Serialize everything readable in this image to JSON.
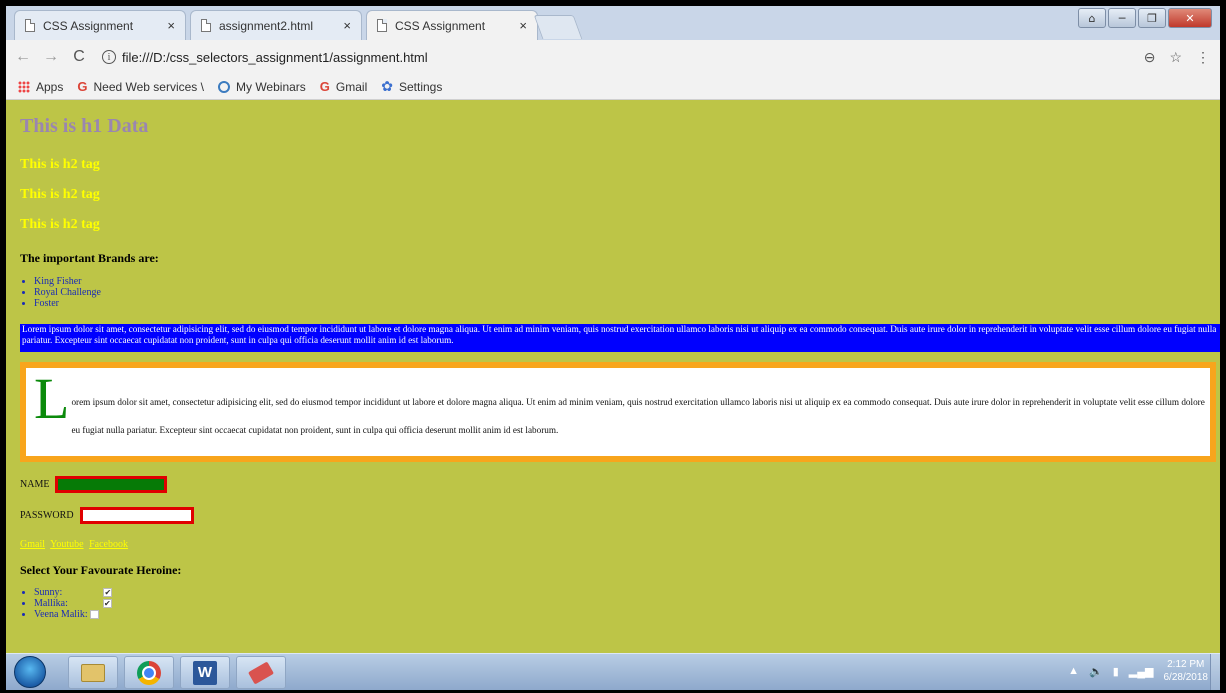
{
  "tabs": [
    {
      "title": "CSS Assignment",
      "close": "×",
      "active": false
    },
    {
      "title": "assignment2.html",
      "close": "×",
      "active": false
    },
    {
      "title": "CSS Assignment",
      "close": "×",
      "active": true
    }
  ],
  "window_controls": {
    "minimize": "─",
    "maximize": "❐",
    "close": "✕"
  },
  "toolbar": {
    "back": "←",
    "forward": "→",
    "reload": "C",
    "info": "i",
    "url": "file:///D:/css_selectors_assignment1/assignment.html",
    "zoom": "⊖",
    "star": "☆",
    "menu": "⋮"
  },
  "bookmarks": [
    {
      "label": "Apps",
      "icon": "apps-icon"
    },
    {
      "label": "Need Web services \\",
      "icon": "google-icon"
    },
    {
      "label": "My Webinars",
      "icon": "globe-icon"
    },
    {
      "label": "Gmail",
      "icon": "google-icon"
    },
    {
      "label": "Settings",
      "icon": "gear-icon"
    }
  ],
  "page": {
    "h1": "This is h1 Data",
    "h2": [
      "This is h2 tag",
      "This is h2 tag",
      "This is h2 tag"
    ],
    "brands_heading": "The important Brands are:",
    "brands": [
      "King Fisher",
      "Royal Challenge",
      "Foster"
    ],
    "blue_paragraph": "Lorem ipsum dolor sit amet, consectetur adipisicing elit, sed do eiusmod tempor incididunt ut labore et dolore magna aliqua. Ut enim ad minim veniam, quis nostrud exercitation ullamco laboris nisi ut aliquip ex ea commodo consequat. Duis aute irure dolor in reprehenderit in voluptate velit esse cillum dolore eu fugiat nulla pariatur. Excepteur sint occaecat cupidatat non proident, sunt in culpa qui officia deserunt mollit anim id est laborum.",
    "dropcap_letter": "L",
    "boxed_paragraph": "orem ipsum dolor sit amet, consectetur adipisicing elit, sed do eiusmod tempor incididunt ut labore et dolore magna aliqua. Ut enim ad minim veniam, quis nostrud exercitation ullamco laboris nisi ut aliquip ex ea commodo consequat. Duis aute irure dolor in reprehenderit in voluptate velit esse cillum dolore eu fugiat nulla pariatur. Excepteur sint occaecat cupidatat non proident, sunt in culpa qui officia deserunt mollit anim id est laborum.",
    "name_label": "NAME",
    "name_value": "",
    "password_label": "PASSWORD",
    "password_value": "",
    "links": [
      "Gmail",
      "Youtube",
      "Facebook"
    ],
    "heroine_heading": "Select Your Favourate Heroine:",
    "heroines": [
      {
        "label": "Sunny:",
        "checked": true
      },
      {
        "label": "Mallika:",
        "checked": true
      },
      {
        "label": "Veena Malik:",
        "checked": false
      }
    ]
  },
  "taskbar": {
    "apps": [
      "folder-icon",
      "chrome-icon",
      "word-icon",
      "eraser-icon"
    ],
    "word_letter": "W",
    "tray_icons": {
      "up": "▲",
      "volume": "🔈"
    },
    "time": "2:12 PM",
    "date": "6/28/2018"
  },
  "colors": {
    "page_background": "#bdc547",
    "h1": "#9a86b0",
    "h2": "#ffff00",
    "list": "#1a2bb5",
    "blue_block": "#0000ff",
    "box_border": "#f8a51c",
    "dropcap": "#0b8a0b",
    "input_border": "#e00000",
    "name_input_bg": "#067a06"
  }
}
